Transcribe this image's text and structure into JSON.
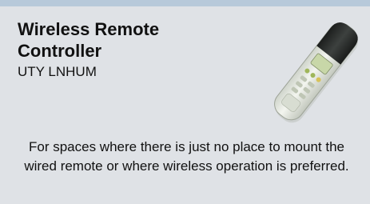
{
  "card": {
    "title_line1": "Wireless Remote",
    "title_line2": "Controller",
    "model": "UTY LNHUM",
    "description": "For spaces where there is just no place to mount the wired remote or where wireless operation is preferred."
  },
  "image": {
    "icon": "remote-controller-icon"
  },
  "colors": {
    "card_background": "#dfe2e6",
    "top_bar": "#b7c9da",
    "remote_body": "#ecefe6",
    "remote_head": "#2a2d2b",
    "remote_buttons_accent": "#9fb65a"
  }
}
